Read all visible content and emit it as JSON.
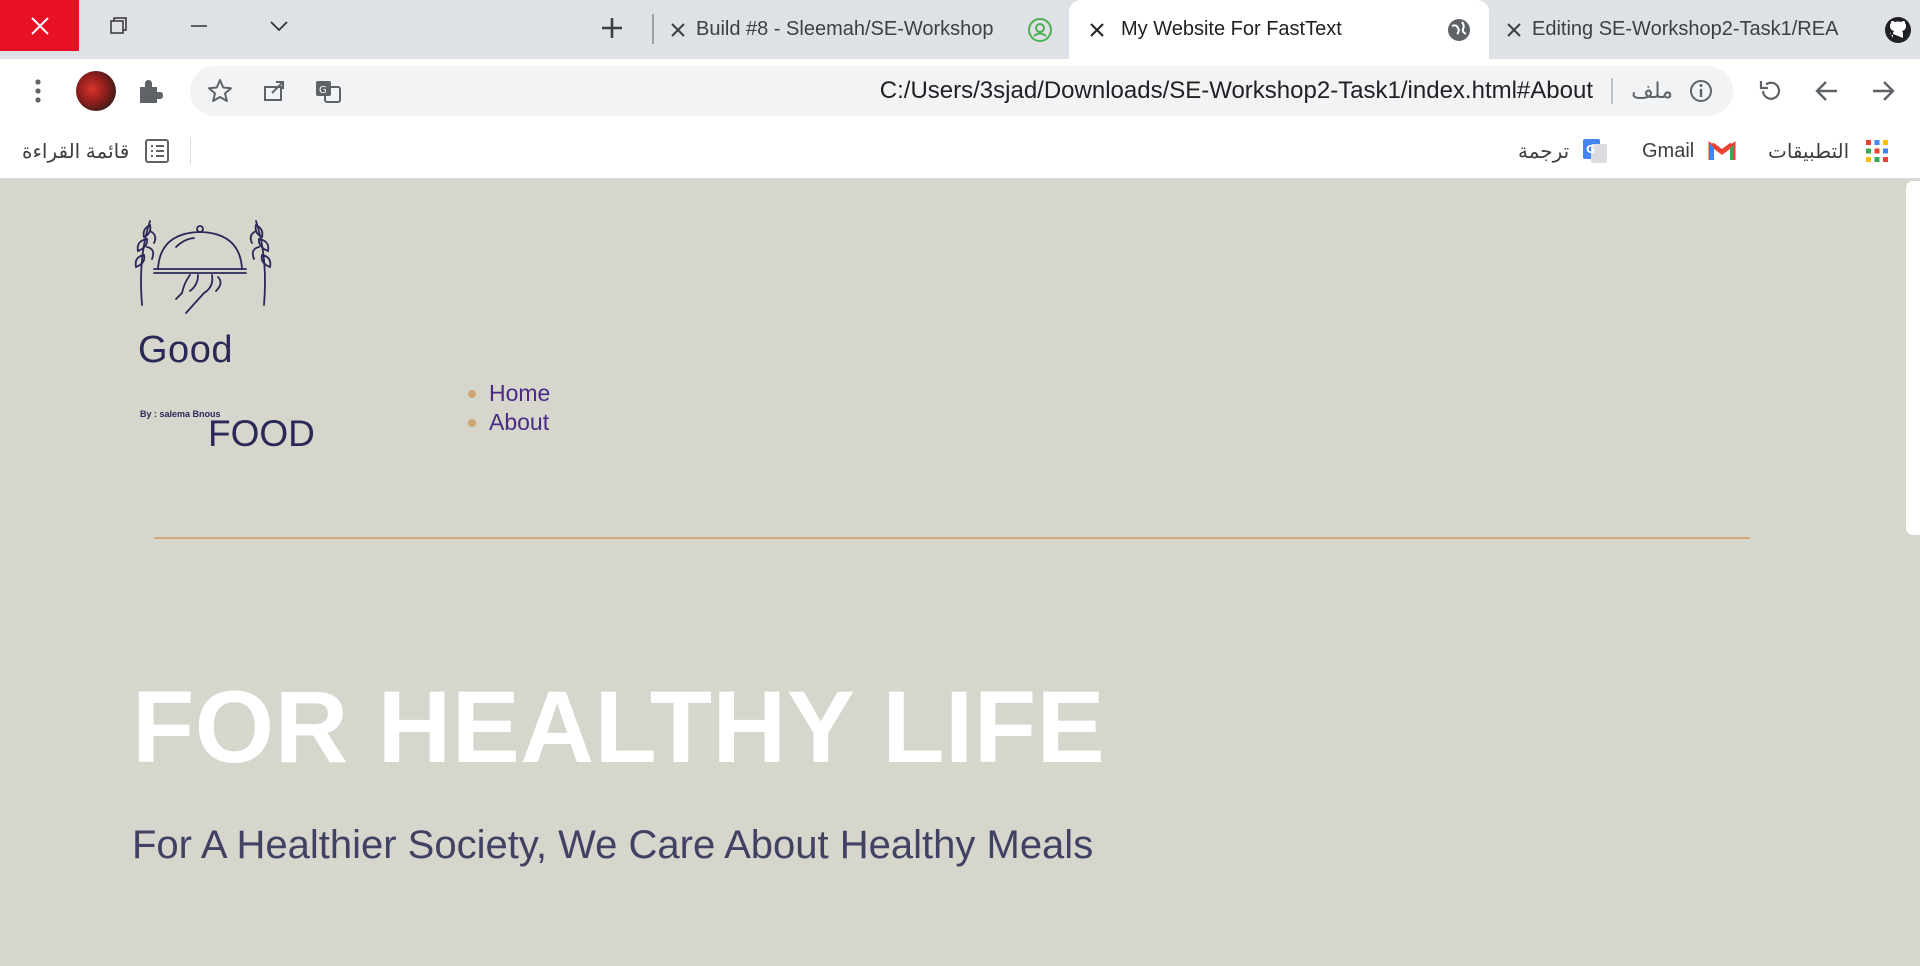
{
  "browser": {
    "tabs": [
      {
        "title": "Build #8 - Sleemah/SE-Workshop",
        "active": false
      },
      {
        "title": "My Website For FastText",
        "active": true
      },
      {
        "title": "Editing SE-Workshop2-Task1/REA",
        "active": false
      }
    ],
    "url": "C:/Users/3sjad/Downloads/SE-Workshop2-Task1/index.html#About",
    "file_label": "ملف"
  },
  "bookmarks": {
    "reading_list": "قائمة القراءة",
    "translate": "ترجمة",
    "gmail": "Gmail",
    "apps": "التطبيقات"
  },
  "site": {
    "logo": {
      "word1": "Good",
      "byline": "By : salema Bnous",
      "word2": "FOOD"
    },
    "nav": [
      {
        "label": "Home"
      },
      {
        "label": "About"
      }
    ],
    "hero": {
      "title": "FOR HEALTHY LIFE",
      "subtitle": "For A Healthier Society, We Care About Healthy Meals"
    }
  },
  "colors": {
    "window_close": "#e81123",
    "page_background": "#d6d6cc",
    "logo": "#2a2859",
    "nav_link": "#4b2a86",
    "accent": "#d2ac7e",
    "hero_title": "#ffffff",
    "hero_subtitle": "#414263"
  }
}
